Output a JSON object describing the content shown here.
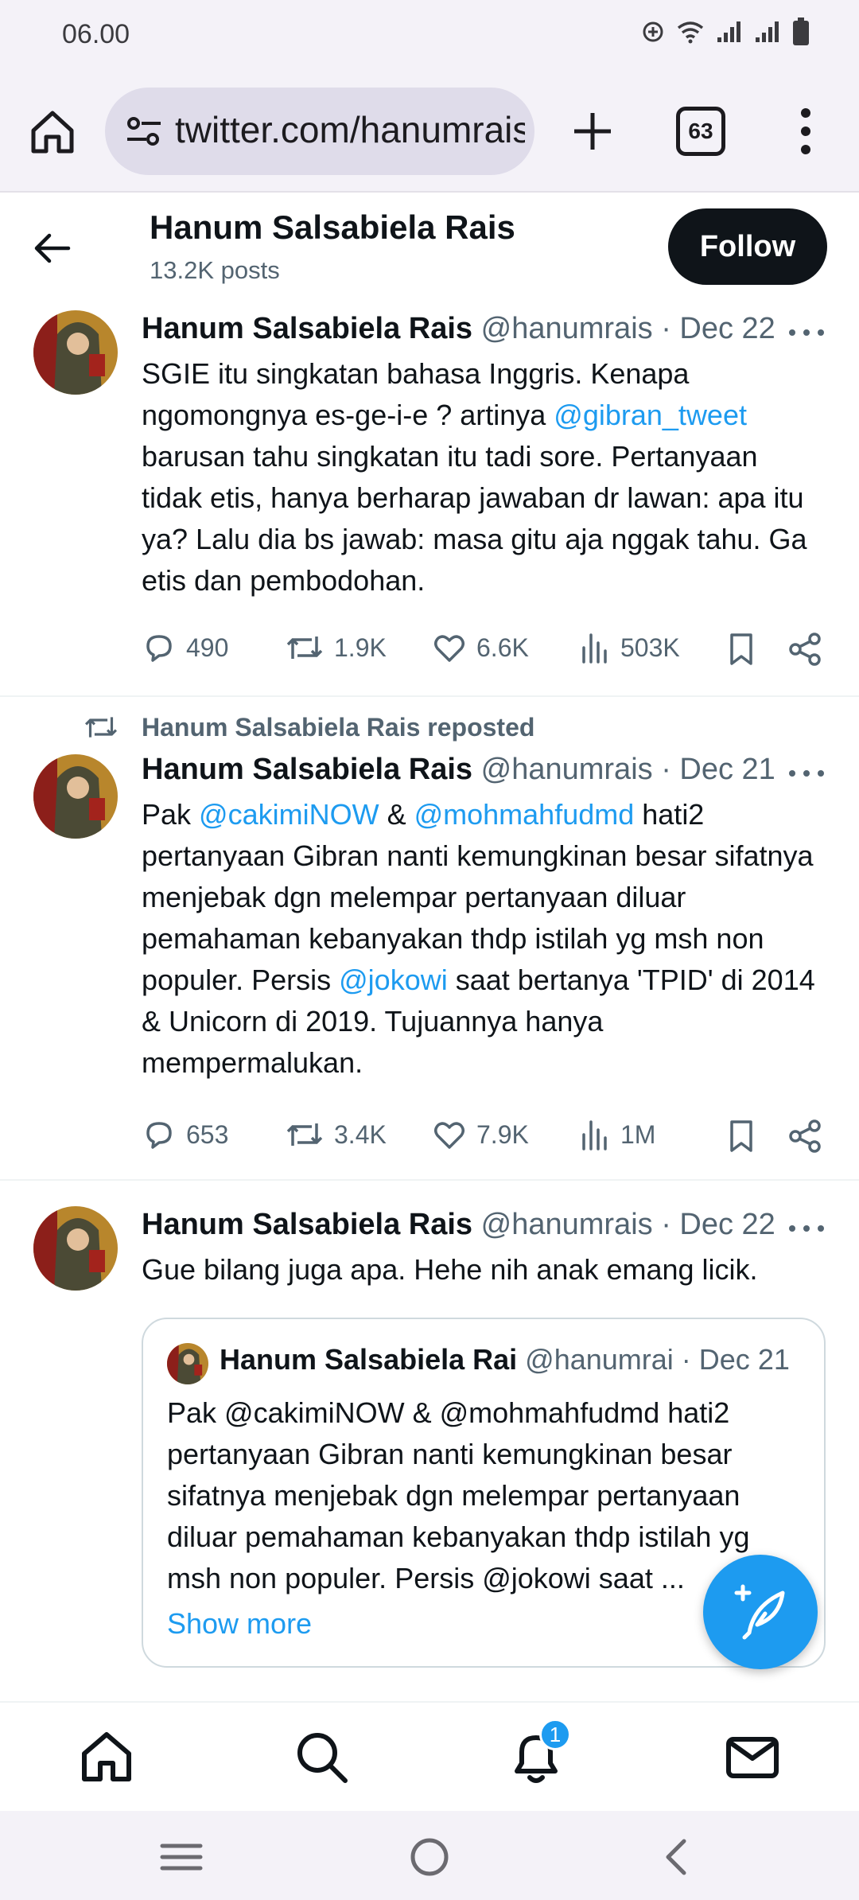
{
  "status_bar": {
    "time": "06.00"
  },
  "browser": {
    "url": "twitter.com/hanumrais",
    "tab_count": "63"
  },
  "profile": {
    "name": "Hanum Salsabiela Rais",
    "posts": "13.2K posts",
    "follow_label": "Follow"
  },
  "tweets": [
    {
      "name": "Hanum Salsabiela Rais",
      "meta": "@hanumrais · Dec 22",
      "body_parts": {
        "t1": "SGIE itu singkatan bahasa Inggris. Kenapa ngomongnya es-ge-i-e ? artinya ",
        "m1": "@gibran_tweet",
        "t2": " barusan tahu singkatan itu tadi sore. Pertanyaan tidak etis, hanya berharap jawaban dr lawan: apa itu ya? Lalu dia bs jawab: masa gitu aja nggak tahu. Ga etis dan pembodohan."
      },
      "replies": "490",
      "reposts": "1.9K",
      "likes": "6.6K",
      "views": "503K"
    },
    {
      "repost_note": "Hanum Salsabiela Rais reposted",
      "name": "Hanum Salsabiela Rais",
      "meta": "@hanumrais · Dec 21",
      "body_parts": {
        "t1": "Pak ",
        "m1": "@cakimiNOW",
        "t2": " & ",
        "m2": "@mohmahfudmd",
        "t3": "  hati2 pertanyaan Gibran nanti kemungkinan besar sifatnya menjebak  dgn melempar pertanyaan diluar pemahaman kebanyakan thdp istilah yg msh non populer. Persis ",
        "m3": "@jokowi",
        "t4": " saat bertanya 'TPID' di 2014 & Unicorn di 2019. Tujuannya hanya mempermalukan."
      },
      "replies": "653",
      "reposts": "3.4K",
      "likes": "7.9K",
      "views": "1M"
    },
    {
      "name": "Hanum Salsabiela Rais",
      "meta": "@hanumrais · Dec 22",
      "body": "Gue bilang juga apa. Hehe nih anak emang licik.",
      "quote": {
        "name": "Hanum Salsabiela Rai",
        "meta": "@hanumrai · Dec 21",
        "body": "Pak @cakimiNOW & @mohmahfudmd  hati2 pertanyaan Gibran nanti kemungkinan besar sifatnya menjebak  dgn melempar pertanyaan diluar pemahaman kebanyakan thdp istilah yg msh non populer. Persis @jokowi saat ...",
        "show_more": "Show more"
      }
    }
  ],
  "bottom_nav": {
    "notification_count": "1"
  },
  "colors": {
    "accent": "#1d9bf0",
    "text": "#0f1419",
    "muted": "#536471"
  }
}
